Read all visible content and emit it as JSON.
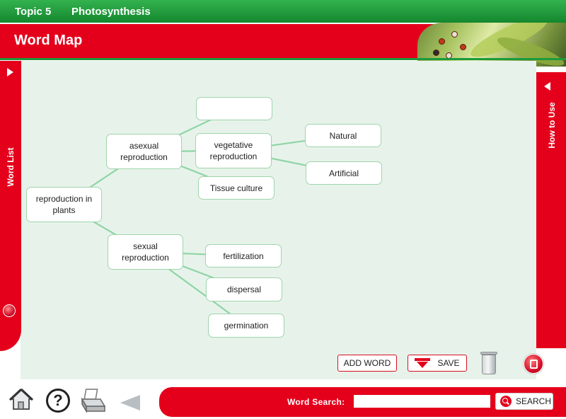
{
  "header": {
    "topic": "Topic 5",
    "chapter": "Photosynthesis"
  },
  "page": {
    "title": "Word Map"
  },
  "side_tabs": {
    "left": "Word List",
    "right": "How to Use"
  },
  "word_map": {
    "nodes": [
      {
        "id": "root",
        "label": "reproduction in plants"
      },
      {
        "id": "asexual",
        "label": "asexual reproduction"
      },
      {
        "id": "empty",
        "label": ""
      },
      {
        "id": "vegetative",
        "label": "vegetative reproduction"
      },
      {
        "id": "tissue",
        "label": "Tissue culture"
      },
      {
        "id": "natural",
        "label": "Natural"
      },
      {
        "id": "artificial",
        "label": "Artificial"
      },
      {
        "id": "sexual",
        "label": "sexual reproduction"
      },
      {
        "id": "fert",
        "label": "fertilization"
      },
      {
        "id": "dispersal",
        "label": "dispersal"
      },
      {
        "id": "germ",
        "label": "germination"
      }
    ],
    "links": [
      [
        "root",
        "asexual"
      ],
      [
        "root",
        "sexual"
      ],
      [
        "asexual",
        "empty"
      ],
      [
        "asexual",
        "vegetative"
      ],
      [
        "asexual",
        "tissue"
      ],
      [
        "vegetative",
        "natural"
      ],
      [
        "vegetative",
        "artificial"
      ],
      [
        "sexual",
        "fert"
      ],
      [
        "sexual",
        "dispersal"
      ],
      [
        "sexual",
        "germ"
      ]
    ]
  },
  "toolbar": {
    "add_word": "ADD WORD",
    "save": "SAVE"
  },
  "footer": {
    "search_label": "Word Search:",
    "search_value": "",
    "search_button": "SEARCH",
    "icons": [
      "home-icon",
      "help-icon",
      "print-icon",
      "back-arrow-icon",
      "trash-icon",
      "exit-icon"
    ]
  },
  "colors": {
    "green": "#1d9a3c",
    "red": "#e4001b",
    "canvas": "#e7f3ea",
    "node_border": "#9fd4ac",
    "link": "#8fd4a6"
  }
}
